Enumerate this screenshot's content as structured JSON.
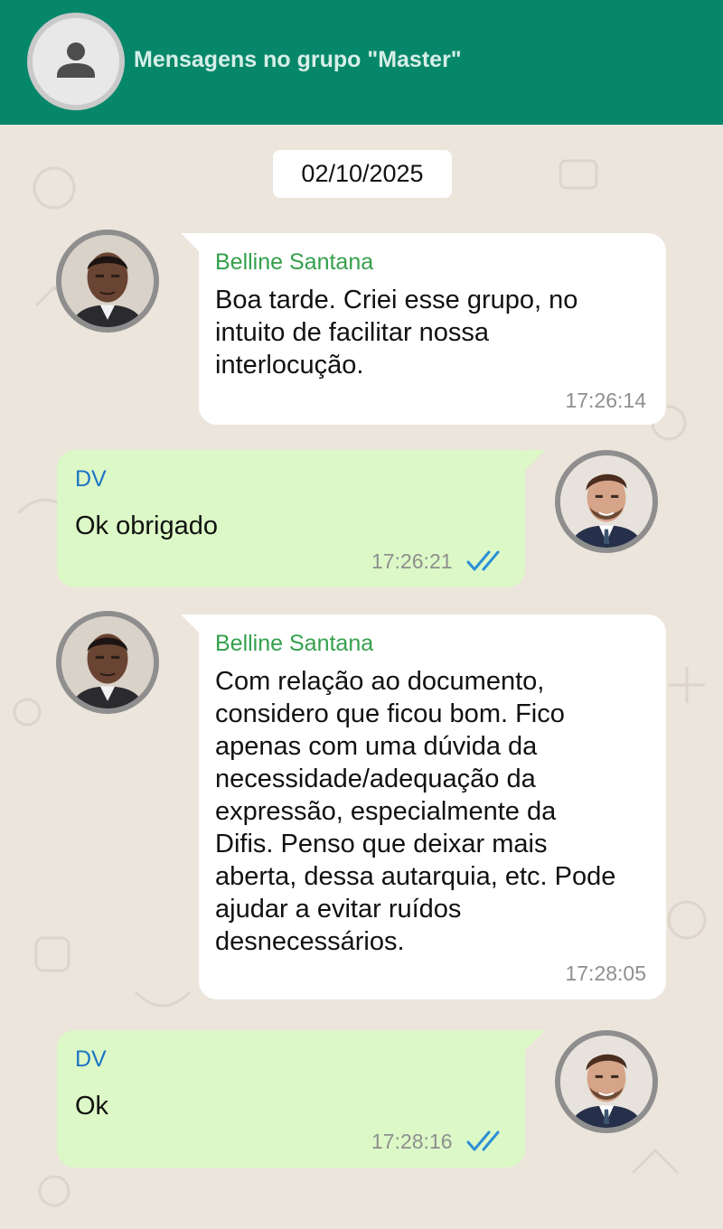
{
  "header": {
    "title": "Mensagens no grupo \"Master\""
  },
  "chat": {
    "date": "02/10/2025",
    "messages": [
      {
        "sender": "Belline Santana",
        "lines": [
          "Boa tarde. Criei esse grupo, no",
          "intuito de facilitar nossa",
          "interlocução."
        ],
        "time": "17:26:14"
      },
      {
        "sender": "DV",
        "lines": [
          "Ok obrigado"
        ],
        "time": "17:26:21"
      },
      {
        "sender": "Belline Santana",
        "lines": [
          "Com relação ao documento,",
          "considero que ficou bom. Fico",
          "apenas com uma dúvida da",
          "necessidade/adequação da",
          "expressão, especialmente da",
          "Difis. Penso que deixar mais",
          "aberta, dessa autarquia, etc. Pode",
          "ajudar a evitar ruídos",
          "desnecessários."
        ],
        "time": "17:28:05"
      },
      {
        "sender": "DV",
        "lines": [
          "Ok"
        ],
        "time": "17:28:16"
      }
    ]
  },
  "colors": {
    "header_bg": "#07876a",
    "incoming_bubble": "#ffffff",
    "outgoing_bubble": "#dcf8c6",
    "incoming_sender": "#34a04c",
    "outgoing_sender": "#1d74c6",
    "read_ticks": "#2b8fd6"
  },
  "icons": {
    "header_avatar": "user-placeholder-icon",
    "read_receipt": "double-check-icon"
  }
}
